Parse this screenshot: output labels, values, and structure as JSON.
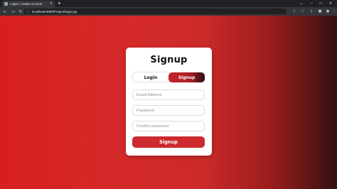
{
  "browser": {
    "tab_title": "Login | Create Account",
    "tab_close": "×",
    "new_tab": "+",
    "url": "localhost:8080/Project/login.jsp",
    "window_controls": {
      "minimize": "–",
      "maximize": "□",
      "close": "✕"
    },
    "nav": {
      "back": "←",
      "forward": "→",
      "reload": "↻"
    },
    "toolbar_icons": [
      "share-icon",
      "star-icon",
      "sidebar-icon",
      "extension-icon",
      "profile-icon",
      "menu-icon"
    ]
  },
  "page": {
    "gradient": [
      "#d81f1f",
      "#d42a2a",
      "#9c1d1d",
      "#351010"
    ],
    "card": {
      "title": "Signup",
      "switch": {
        "login": "Login",
        "signup": "Signup",
        "active": "signup"
      },
      "fields": [
        {
          "placeholder": "Email Address"
        },
        {
          "placeholder": "Password"
        },
        {
          "placeholder": "Confirm password"
        }
      ],
      "submit": "Signup",
      "accent": "#cc2a2f"
    }
  }
}
